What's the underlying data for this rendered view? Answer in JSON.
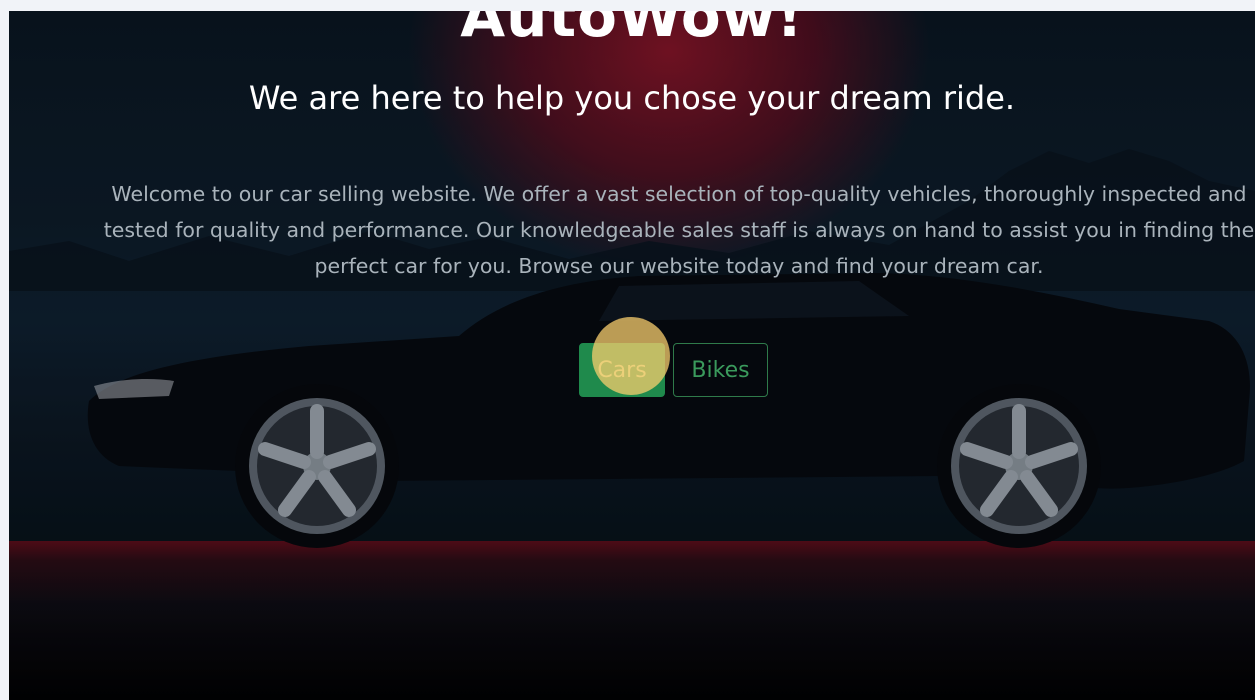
{
  "hero": {
    "title": "AutoWow!",
    "subtitle": "We are here to help you chose your dream ride.",
    "intro_lines": [
      "Welcome to our car selling website. We offer a vast selection of top-quality vehicles, thoroughly inspected and",
      "tested for quality and performance. Our knowledgeable sales staff is always on hand to assist you in finding the",
      "perfect car for you. Browse our website today and find your dream car."
    ]
  },
  "buttons": {
    "cars_label": "Cars",
    "bikes_label": "Bikes"
  },
  "colors": {
    "primary_button": "#1f8a4c",
    "outline_button_text": "#3a9a5c",
    "click_marker": "#f8cd6e"
  }
}
